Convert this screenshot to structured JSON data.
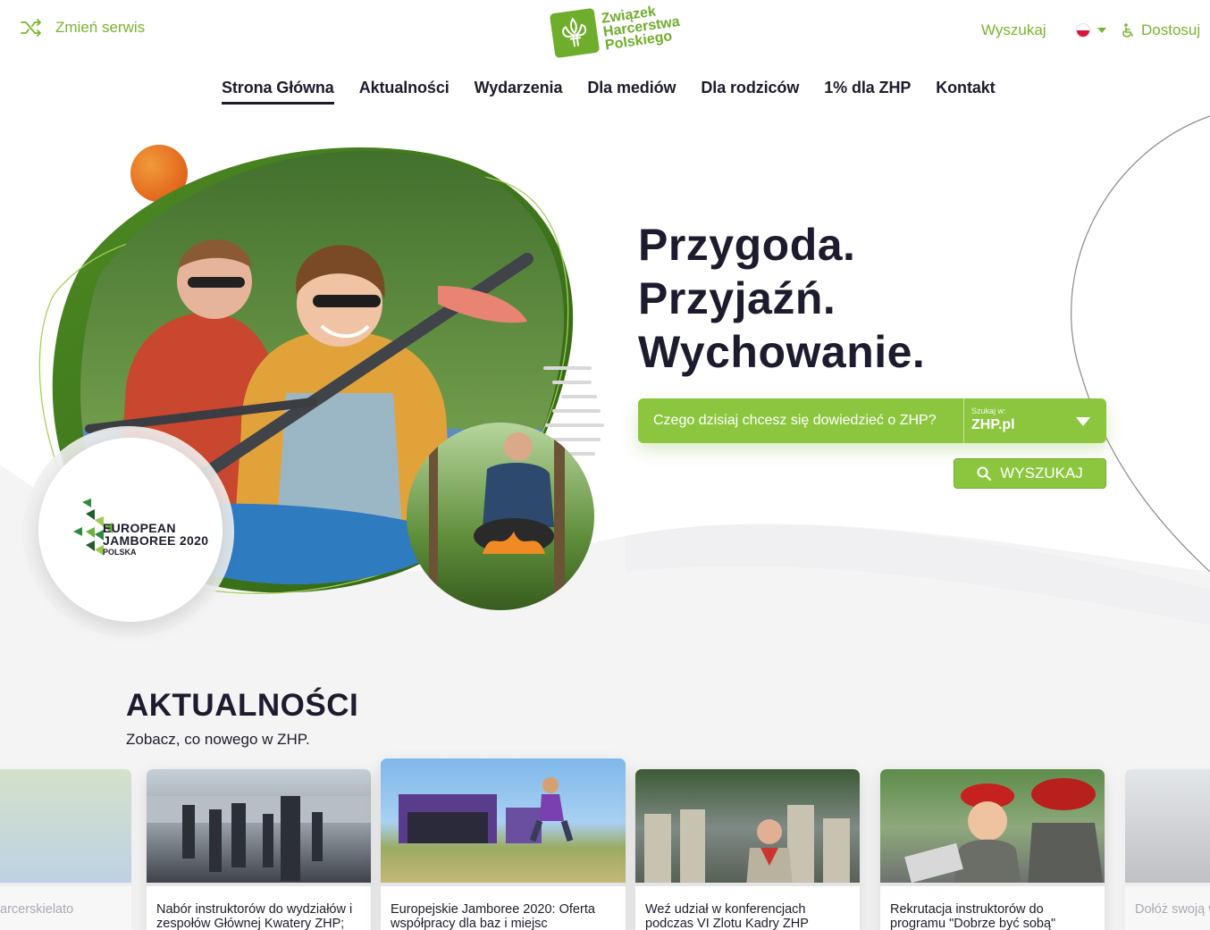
{
  "header": {
    "switch_service_label": "Zmień serwis",
    "logo_lines": [
      "Związek",
      "Harcerstwa",
      "Polskiego"
    ],
    "logo_mark": "ZHP",
    "search_label": "Wyszukaj",
    "adjust_label": "Dostosuj"
  },
  "nav": {
    "items": [
      {
        "label": "Strona Główna",
        "active": true
      },
      {
        "label": "Aktualności"
      },
      {
        "label": "Wydarzenia"
      },
      {
        "label": "Dla mediów"
      },
      {
        "label": "Dla rodziców"
      },
      {
        "label": "1% dla ZHP"
      },
      {
        "label": "Kontakt"
      }
    ]
  },
  "hero": {
    "headline": [
      "Przygoda.",
      "Przyjaźń.",
      "Wychowanie."
    ],
    "search_placeholder": "Czego dzisiaj chcesz się dowiedzieć o ZHP?",
    "scope_label": "Szukaj w:",
    "scope_value": "ZHP.pl",
    "search_button": "WYSZUKAJ",
    "badge": {
      "line1": "EUROPEAN",
      "line2": "JAMBOREE 2020",
      "line3": "POLSKA"
    }
  },
  "news": {
    "title": "AKTUALNOŚCI",
    "subtitle": "Zobacz, co nowego w ZHP.",
    "cards": [
      {
        "title": "arcerskielato"
      },
      {
        "title": "Nabór instruktorów do wydziałów i zespołów Głównej Kwatery ZHP;"
      },
      {
        "title": "Europejskie Jamboree 2020: Oferta współpracy dla baz i miejsc"
      },
      {
        "title": "Weź udział w konferencjach podczas VI Zlotu Kadry ZHP"
      },
      {
        "title": "Rekrutacja instruktorów do programu \"Dobrze być sobą\""
      },
      {
        "title": "Dołóż swoją współczesne"
      }
    ]
  },
  "colors": {
    "brand_green": "#8cc63f",
    "logo_green": "#6fae2d",
    "text_dark": "#1c1c2e",
    "accent_orange": "#e8731e"
  },
  "icons": {
    "switch": "shuffle-icon",
    "adjust": "accessibility-icon",
    "search": "search-icon",
    "language": "polish-flag-icon"
  }
}
